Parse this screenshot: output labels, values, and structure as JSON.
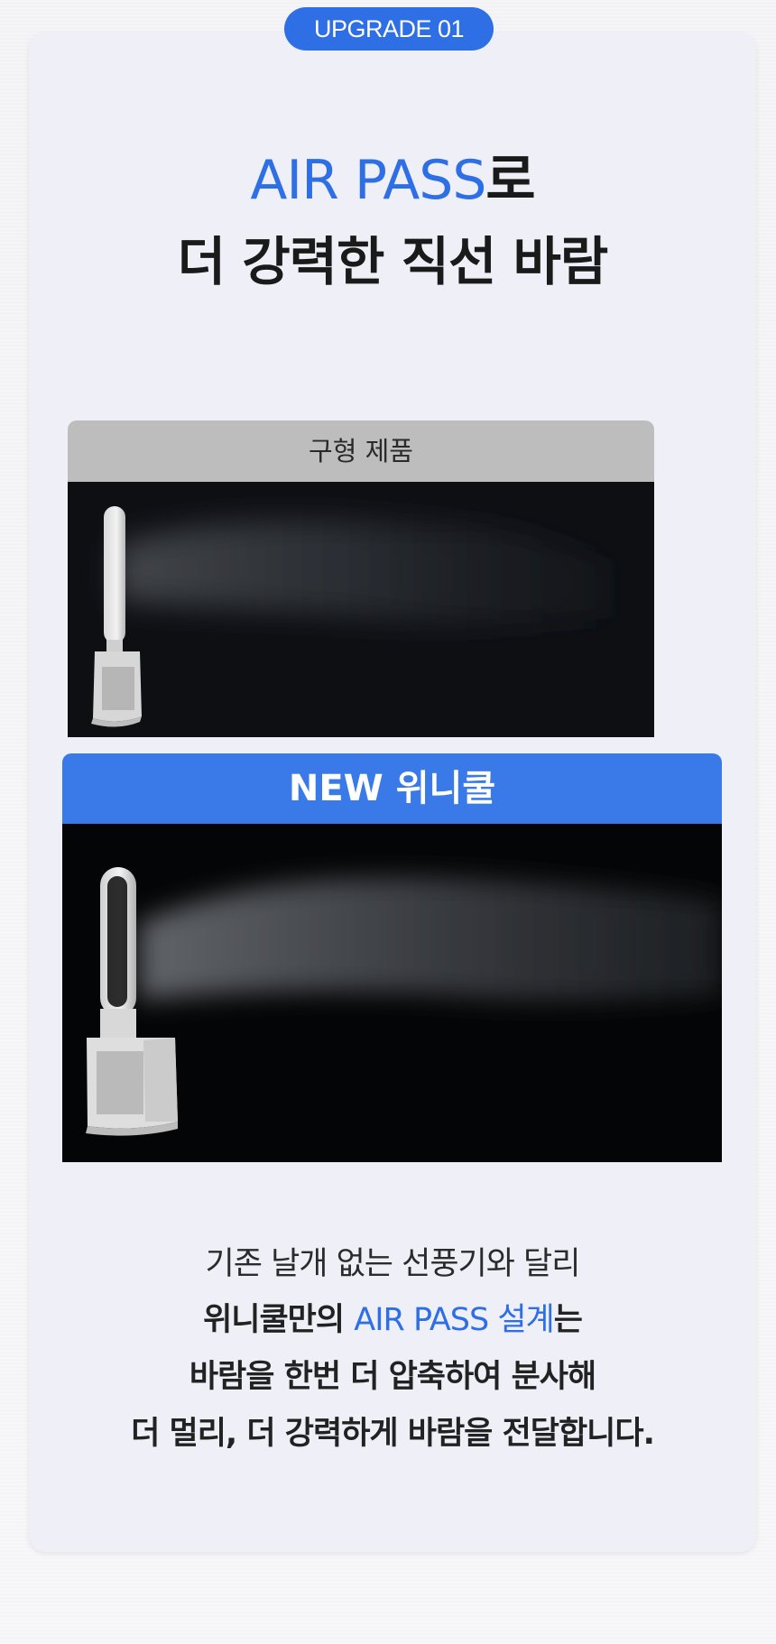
{
  "badge": {
    "label": "UPGRADE 01"
  },
  "headline": {
    "line1_accent": "AIR PASS",
    "line1_rest": "로",
    "line2": "더 강력한 직선 바람"
  },
  "comparison": {
    "old_label": "구형 제품",
    "new_label": "NEW 위니쿨"
  },
  "description": {
    "line1": "기존 날개 없는 선풍기와 달리",
    "line2_prefix": "위니쿨만의 ",
    "line2_accent": "AIR PASS 설계",
    "line2_suffix": "는",
    "line3": "바람을 한번 더 압축하여 분사해",
    "line4": "더 멀리, 더 강력하게 바람을 전달합니다."
  },
  "colors": {
    "accent": "#2f6fe6",
    "old_header_bg": "#bdbdbd",
    "new_header_bg": "#3a7ae8"
  }
}
